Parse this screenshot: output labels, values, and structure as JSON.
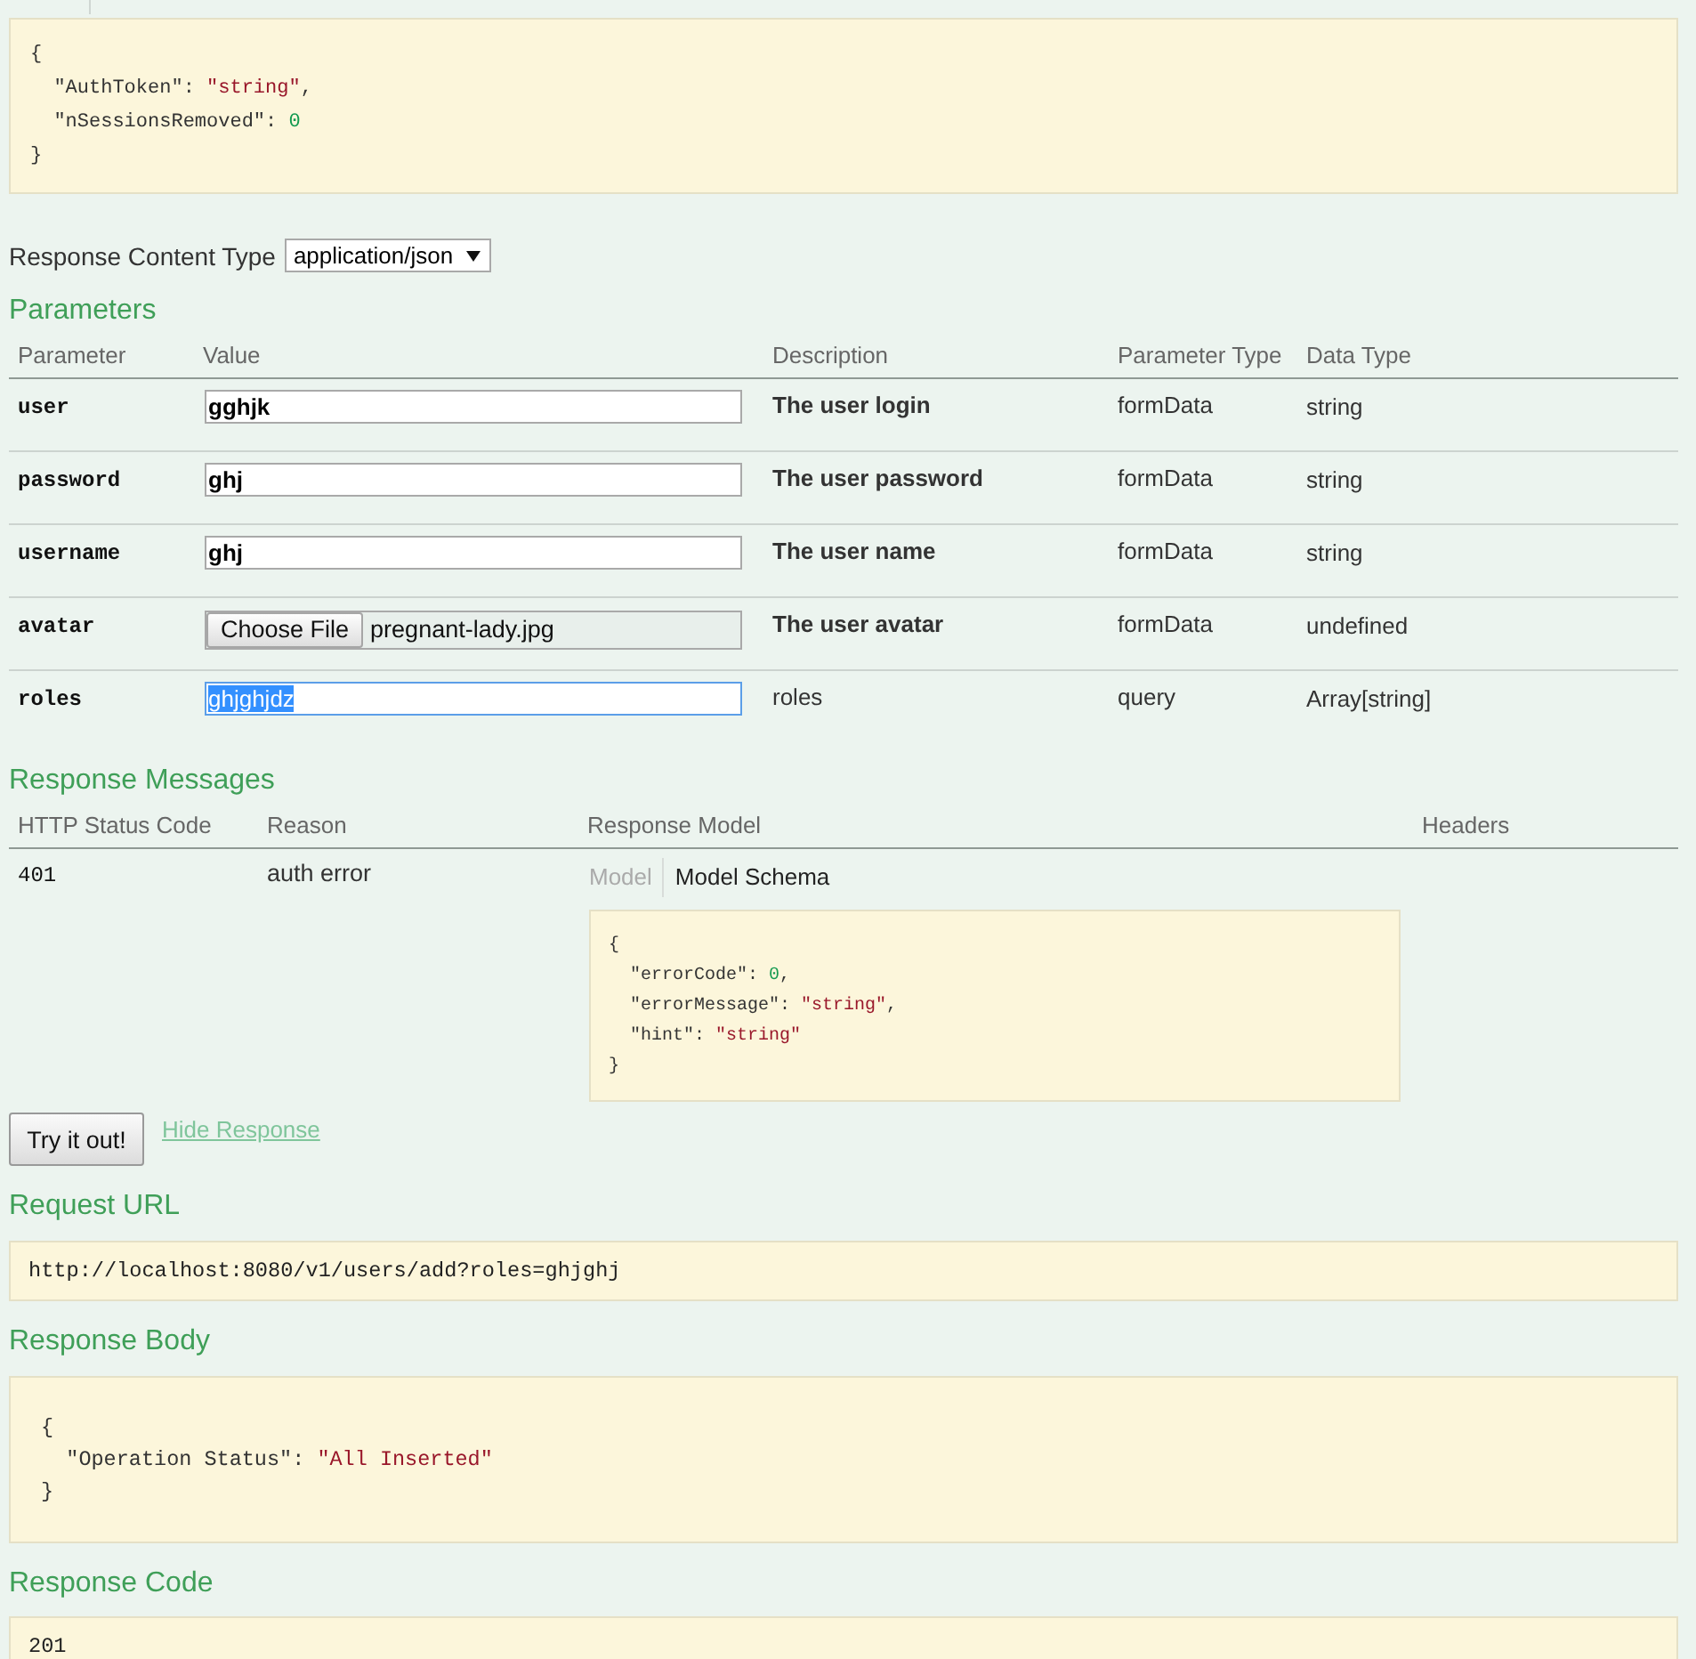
{
  "response_model_example": {
    "lines": [
      [
        {
          "text": "{",
          "kind": "plain"
        }
      ],
      [
        {
          "text": "  \"AuthToken\": ",
          "kind": "plain"
        },
        {
          "text": "\"string\"",
          "kind": "string"
        },
        {
          "text": ",",
          "kind": "plain"
        }
      ],
      [
        {
          "text": "  \"nSessionsRemoved\": ",
          "kind": "plain"
        },
        {
          "text": "0",
          "kind": "number"
        }
      ],
      [
        {
          "text": "}",
          "kind": "plain"
        }
      ]
    ]
  },
  "response_content_type": {
    "label": "Response Content Type",
    "value": "application/json"
  },
  "parameters": {
    "title": "Parameters",
    "columns": [
      "Parameter",
      "Value",
      "Description",
      "Parameter Type",
      "Data Type"
    ],
    "rows": [
      {
        "name": "user",
        "kind": "text",
        "value": "gghjk",
        "focused": false,
        "text_selected": false,
        "bold": true,
        "description": "The user login",
        "parameter_type": "formData",
        "data_type": "string"
      },
      {
        "name": "password",
        "kind": "text",
        "value": "ghj",
        "focused": false,
        "text_selected": false,
        "bold": true,
        "description": "The user password",
        "parameter_type": "formData",
        "data_type": "string"
      },
      {
        "name": "username",
        "kind": "text",
        "value": "ghj",
        "focused": false,
        "text_selected": false,
        "bold": true,
        "description": "The user name",
        "parameter_type": "formData",
        "data_type": "string"
      },
      {
        "name": "avatar",
        "kind": "file",
        "button": "Choose File",
        "value": "pregnant-lady.jpg",
        "focused": false,
        "text_selected": false,
        "bold": true,
        "description": "The user avatar",
        "parameter_type": "formData",
        "data_type": "undefined"
      },
      {
        "name": "roles",
        "kind": "text",
        "value": "ghjghjdz",
        "focused": true,
        "text_selected": true,
        "bold": false,
        "description": "roles",
        "parameter_type": "query",
        "data_type": "Array[string]"
      }
    ]
  },
  "response_messages": {
    "title": "Response Messages",
    "columns": [
      "HTTP Status Code",
      "Reason",
      "Response Model",
      "Headers"
    ],
    "rows": [
      {
        "status_code": "401",
        "reason": "auth error",
        "model_tabs": [
          {
            "label": "Model",
            "selected": false
          },
          {
            "label": "Model Schema",
            "selected": true
          }
        ],
        "schema_lines": [
          [
            {
              "text": "{",
              "kind": "plain"
            }
          ],
          [
            {
              "text": "  \"errorCode\": ",
              "kind": "plain"
            },
            {
              "text": "0",
              "kind": "number"
            },
            {
              "text": ",",
              "kind": "plain"
            }
          ],
          [
            {
              "text": "  \"errorMessage\": ",
              "kind": "plain"
            },
            {
              "text": "\"string\"",
              "kind": "string"
            },
            {
              "text": ",",
              "kind": "plain"
            }
          ],
          [
            {
              "text": "  \"hint\": ",
              "kind": "plain"
            },
            {
              "text": "\"string\"",
              "kind": "string"
            }
          ],
          [
            {
              "text": "}",
              "kind": "plain"
            }
          ]
        ]
      }
    ]
  },
  "try_button": "Try it out!",
  "hide_response_link": "Hide Response",
  "request_url": {
    "title": "Request URL",
    "value": "http://localhost:8080/v1/users/add?roles=ghjghj"
  },
  "response_body": {
    "title": "Response Body",
    "lines": [
      [
        {
          "text": " {",
          "kind": "plain"
        }
      ],
      [
        {
          "text": "   \"Operation Status\": ",
          "kind": "plain"
        },
        {
          "text": "\"All Inserted\"",
          "kind": "string"
        }
      ],
      [
        {
          "text": " }",
          "kind": "plain"
        }
      ]
    ]
  },
  "response_code": {
    "title": "Response Code",
    "value": "201"
  }
}
